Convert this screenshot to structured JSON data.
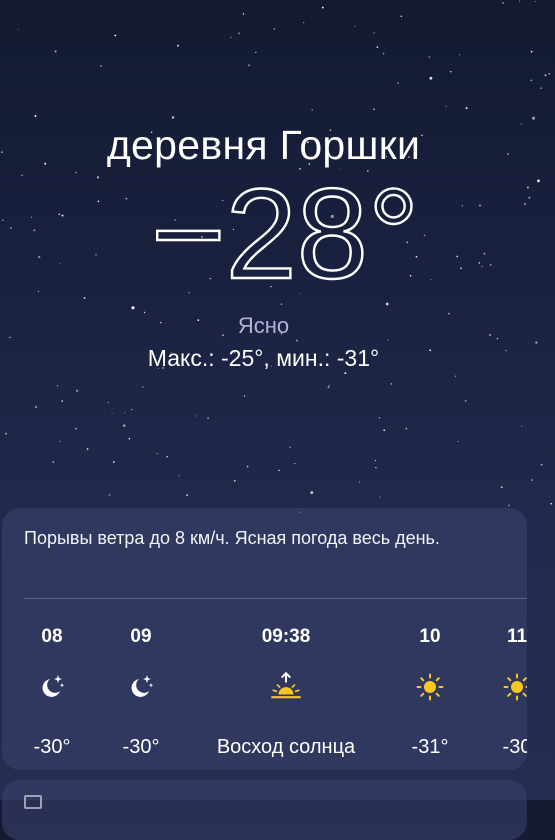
{
  "location": {
    "name": "деревня Горшки"
  },
  "current": {
    "temperature": "−28°",
    "condition": "Ясно",
    "high_low": "Макс.: -25°, мин.: -31°"
  },
  "forecast_card": {
    "summary": "Порывы ветра до 8 км/ч. Ясная погода весь день.",
    "hours": [
      {
        "time": "08",
        "icon": "moon-stars-icon",
        "temp": "-30°"
      },
      {
        "time": "09",
        "icon": "moon-stars-icon",
        "temp": "-30°"
      },
      {
        "time": "09:38",
        "icon": "sunrise-icon",
        "temp": "Восход солнца"
      },
      {
        "time": "10",
        "icon": "sun-icon",
        "temp": "-31°"
      },
      {
        "time": "11",
        "icon": "sun-icon",
        "temp": "-30"
      }
    ]
  },
  "colors": {
    "sun": "#f9c81e",
    "moon": "#ffffff",
    "condition_text": "#b0b3d8",
    "background_top": "#131a31",
    "background_bottom": "#262d50"
  }
}
